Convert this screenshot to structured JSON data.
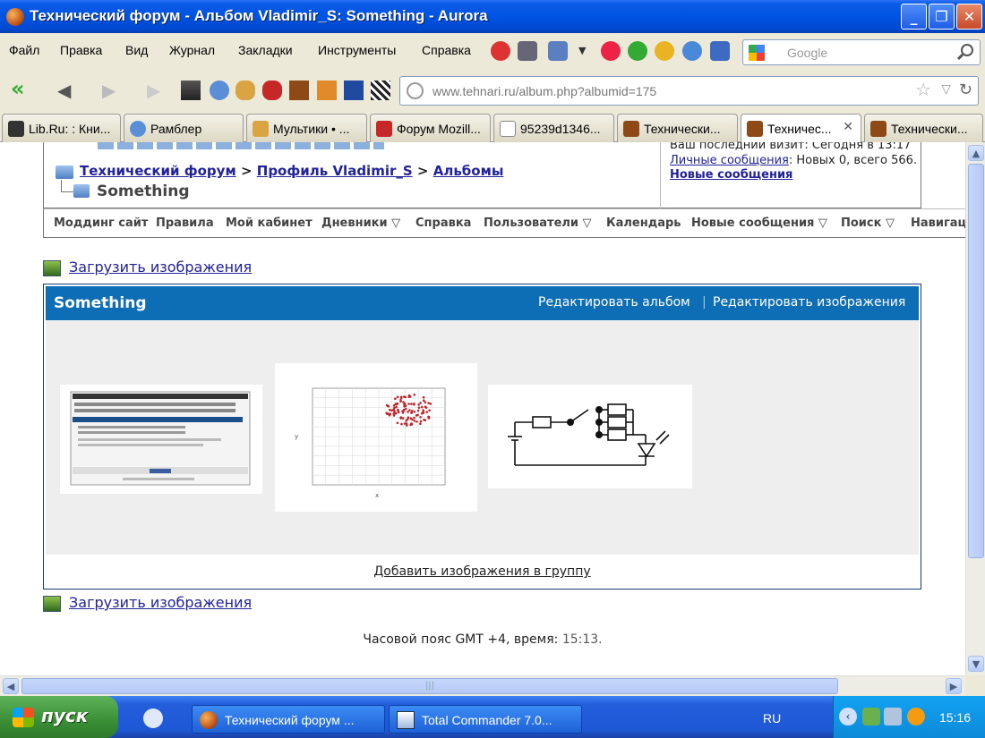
{
  "window": {
    "title": "Технический форум - Альбом Vladimir_S: Something - Aurora"
  },
  "menu": [
    "Файл",
    "Правка",
    "Вид",
    "Журнал",
    "Закладки",
    "Инструменты",
    "Справка"
  ],
  "search": {
    "placeholder": "Google"
  },
  "address": {
    "url": "www.tehnari.ru/album.php?albumid=175"
  },
  "tabs": [
    {
      "label": "Lib.Ru: : Кни..."
    },
    {
      "label": "Рамблер"
    },
    {
      "label": "Мультики • ..."
    },
    {
      "label": "Форум Mozill..."
    },
    {
      "label": "95239d1346..."
    },
    {
      "label": "Технически..."
    },
    {
      "label": "Техничес..."
    },
    {
      "label": "Технически..."
    }
  ],
  "breadcrumb": {
    "forum": "Технический форум",
    "sep1": ">",
    "profile": "Профиль Vladimir_S",
    "sep2": ">",
    "albums": "Альбомы",
    "current": "Something"
  },
  "userbox": {
    "last_visit": "Ваш последний визит: Сегодня в 13:17",
    "pm_link": "Личные сообщения",
    "pm_counts": ": Новых 0, всего 566.",
    "new_posts": "Новые сообщения"
  },
  "nav": [
    "Моддинг сайт",
    "Правила",
    "Мой кабинет",
    "Дневники ▽",
    "Справка",
    "Пользователи ▽",
    "Календарь",
    "Новые сообщения ▽",
    "Поиск ▽",
    "Навигац"
  ],
  "upload_label": "Загрузить изображения",
  "album": {
    "title": "Something",
    "edit_album": "Редактировать альбом",
    "edit_images": "Редактировать изображения",
    "add_to_group": "Добавить изображения в группу"
  },
  "timezone": {
    "text": "Часовой пояс GMT +4, время:",
    "time": "15:13."
  },
  "taskbar": {
    "start": "пуск",
    "apps": [
      "Технический форум ...",
      "Total Commander 7.0..."
    ],
    "lang": "RU",
    "clock": "15:16"
  },
  "colors": {
    "title_blue": "#0054E3",
    "album_header": "#0D6EB6",
    "link": "#22229C"
  }
}
